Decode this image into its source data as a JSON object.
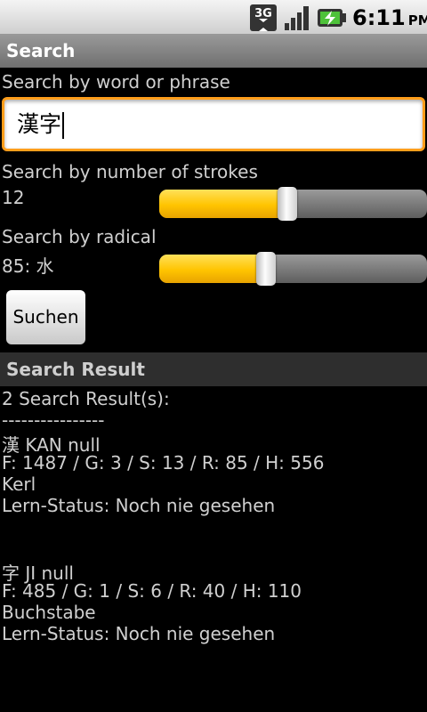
{
  "status_bar": {
    "network_label": "3G",
    "time": "6:11",
    "ampm": "PM",
    "icons": [
      "3g-icon",
      "signal-icon",
      "battery-charging-icon"
    ]
  },
  "search": {
    "header": "Search",
    "word_label": "Search by word or phrase",
    "word_value": "漢字",
    "strokes_label": "Search by number of strokes",
    "strokes_value": "12",
    "strokes_level": 0.48,
    "radical_label": "Search by radical",
    "radical_value": "85: 水",
    "radical_level": 0.4,
    "button_label": "Suchen"
  },
  "results": {
    "header": "Search Result",
    "count_text": "2 Search Result(s):",
    "separator": "----------------",
    "items": [
      {
        "title": "漢 KAN null",
        "details": "F: 1487 / G: 3 / S: 13 / R: 85 / H: 556",
        "meaning": "Kerl",
        "status": "Lern-Status: Noch nie gesehen"
      },
      {
        "title": "字 JI null",
        "details": "F: 485 / G: 1 / S: 6 / R: 40 / H: 110",
        "meaning": "Buchstabe",
        "status": "Lern-Status: Noch nie gesehen"
      }
    ]
  },
  "colors": {
    "accent": "#ffc400",
    "focus_border": "#ff9e1b"
  }
}
